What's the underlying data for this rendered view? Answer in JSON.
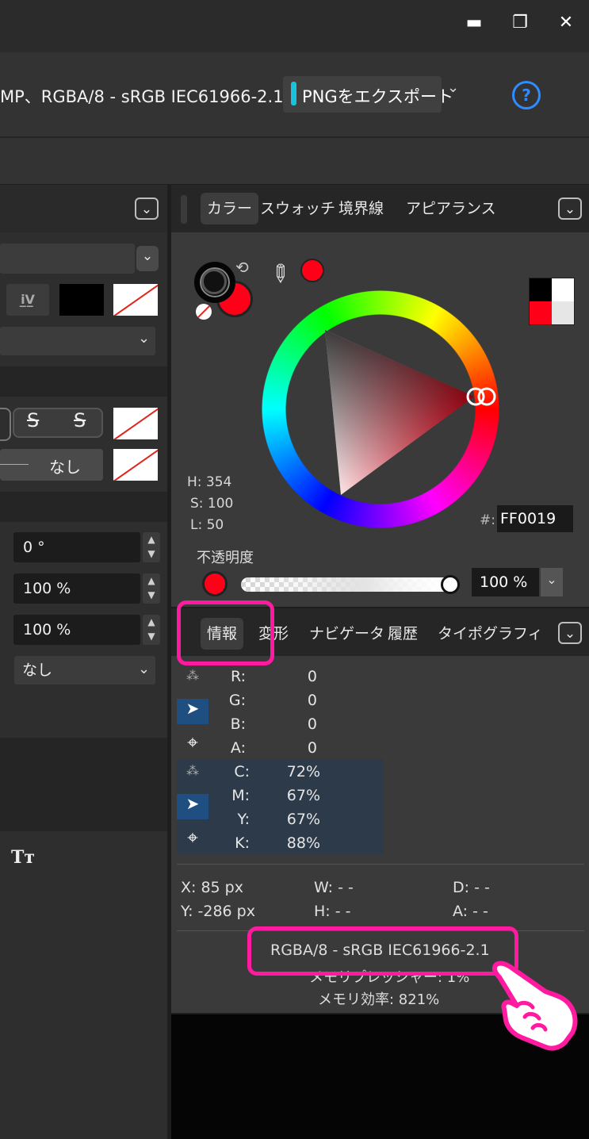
{
  "window": {
    "minimize": "▬",
    "restore": "❐",
    "close": "✕"
  },
  "toolbar": {
    "doc_info": "MP、RGBA/8 - sRGB IEC61966-2.1",
    "export_label": "PNGをエクスポート",
    "export_chevron": "⌄",
    "help": "?"
  },
  "left_panel": {
    "chevron": "⌄",
    "strike1": "S",
    "strike2": "S",
    "none_label": "なし",
    "rotation": "0 °",
    "scale_x": "100 %",
    "scale_y": "100 %",
    "dropdown": "なし",
    "text_icon": "Tт"
  },
  "color_panel": {
    "tabs": [
      "カラー",
      "スウォッチ",
      "境界線",
      "アピアランス"
    ],
    "chevron": "⌄",
    "h": "H: 354",
    "s": "S: 100",
    "l": "L: 50",
    "hex_prefix": "#:",
    "hex": "FF0019",
    "opacity_label": "不透明度",
    "opacity_value": "100 %",
    "selected_color": "#FF0019"
  },
  "info_panel": {
    "tabs": [
      "情報",
      "変形",
      "ナビゲータ",
      "履歴",
      "タイポグラフィ"
    ],
    "chevron": "⌄",
    "rgba": [
      [
        "R:",
        "0"
      ],
      [
        "G:",
        "0"
      ],
      [
        "B:",
        "0"
      ],
      [
        "A:",
        "0"
      ]
    ],
    "cmyk": [
      [
        "C:",
        "72%"
      ],
      [
        "M:",
        "67%"
      ],
      [
        "Y:",
        "67%"
      ],
      [
        "K:",
        "88%"
      ]
    ],
    "x": "X: 85 px",
    "y": "Y:  -286 px",
    "w": "W: - -",
    "h": "H:  - -",
    "d": "D: - -",
    "a": "A: - -",
    "profile": "RGBA/8 - sRGB IEC61966-2.1",
    "memory_pressure": "メモリプレッシャー: 1%",
    "memory_efficiency": "メモリ効率: 821%"
  }
}
